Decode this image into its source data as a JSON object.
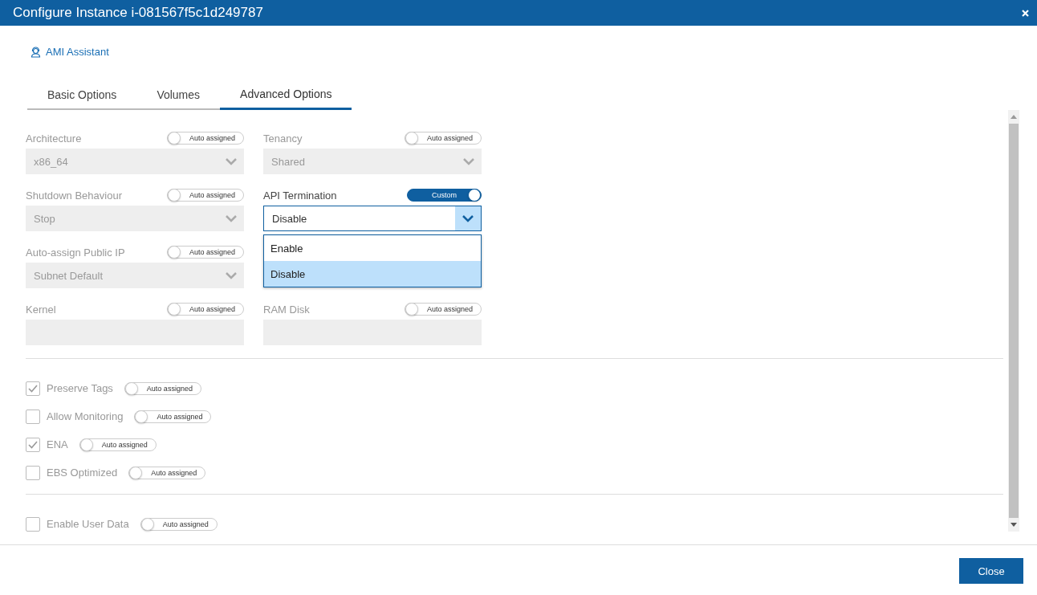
{
  "window": {
    "title": "Configure Instance i-081567f5c1d249787"
  },
  "assistant_link": "AMI Assistant",
  "tabs": [
    {
      "label": "Basic Options",
      "selected": false
    },
    {
      "label": "Volumes",
      "selected": false
    },
    {
      "label": "Advanced Options",
      "selected": true
    }
  ],
  "field_rows": [
    [
      {
        "label": "Architecture",
        "toggle": {
          "label": "Auto assigned",
          "on": false
        },
        "kind": "select",
        "value": "x86_64",
        "disabled": true
      },
      {
        "label": "Tenancy",
        "toggle": {
          "label": "Auto assigned",
          "on": false
        },
        "kind": "select",
        "value": "Shared",
        "disabled": true
      }
    ],
    [
      {
        "label": "Shutdown Behaviour",
        "toggle": {
          "label": "Auto assigned",
          "on": false
        },
        "kind": "select",
        "value": "Stop",
        "disabled": true
      },
      {
        "label": "API Termination",
        "toggle": {
          "label": "Custom",
          "on": true
        },
        "kind": "select",
        "value": "Disable",
        "disabled": false,
        "open": true,
        "options": [
          {
            "label": "Enable",
            "selected": false
          },
          {
            "label": "Disable",
            "selected": true
          }
        ]
      }
    ],
    [
      {
        "label": "Auto-assign Public IP",
        "toggle": {
          "label": "Auto assigned",
          "on": false
        },
        "kind": "select",
        "value": "Subnet Default",
        "disabled": true
      }
    ],
    [
      {
        "label": "Kernel",
        "toggle": {
          "label": "Auto assigned",
          "on": false
        },
        "kind": "text",
        "disabled": true
      },
      {
        "label": "RAM Disk",
        "toggle": {
          "label": "Auto assigned",
          "on": false
        },
        "kind": "text",
        "disabled": true
      }
    ]
  ],
  "checks": [
    {
      "label": "Preserve Tags",
      "checked": true,
      "toggle": {
        "label": "Auto assigned",
        "on": false
      }
    },
    {
      "label": "Allow Monitoring",
      "checked": false,
      "toggle": {
        "label": "Auto assigned",
        "on": false
      }
    },
    {
      "label": "ENA",
      "checked": true,
      "toggle": {
        "label": "Auto assigned",
        "on": false
      }
    },
    {
      "label": "EBS Optimized",
      "checked": false,
      "toggle": {
        "label": "Auto assigned",
        "on": false
      }
    }
  ],
  "user_data": {
    "label": "Enable User Data",
    "checked": false,
    "toggle": {
      "label": "Auto assigned",
      "on": false
    }
  },
  "buttons": [
    "Close"
  ]
}
